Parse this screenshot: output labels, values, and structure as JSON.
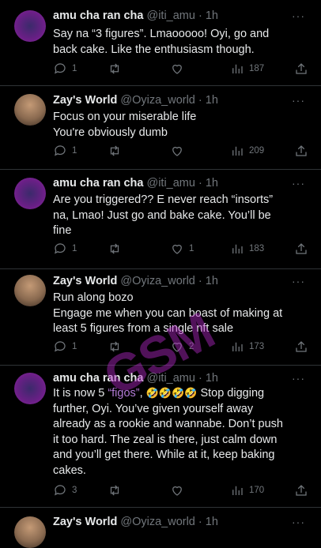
{
  "tweets": [
    {
      "name": "amu cha ran cha",
      "handle": "@iti_amu",
      "sep": "·",
      "time": "1h",
      "text_lines": [
        "Say na “3 figures”. Lmaooooo! Oyi, go and",
        "back cake. Like the enthusiasm though."
      ],
      "replies": "1",
      "retweets": "",
      "likes": "",
      "views": "187"
    },
    {
      "name": "Zay's World",
      "handle": "@Oyiza_world",
      "sep": "·",
      "time": "1h",
      "text_lines": [
        "Focus on your miserable life",
        "You're obviously dumb"
      ],
      "replies": "1",
      "retweets": "",
      "likes": "",
      "views": "209"
    },
    {
      "name": "amu cha ran cha",
      "handle": "@iti_amu",
      "sep": "·",
      "time": "1h",
      "text_lines": [
        "Are you triggered?? E never reach “insorts”",
        "na, Lmao! Just go and bake cake. You’ll be",
        "fine"
      ],
      "replies": "1",
      "retweets": "",
      "likes": "1",
      "views": "183"
    },
    {
      "name": "Zay's World",
      "handle": "@Oyiza_world",
      "sep": "·",
      "time": "1h",
      "text_lines": [
        "Run along bozo",
        "Engage me when you can boast of making at",
        "least 5 figures from a single nft sale"
      ],
      "replies": "1",
      "retweets": "",
      "likes": "2",
      "views": "173"
    },
    {
      "name": "amu cha ran cha",
      "handle": "@iti_amu",
      "sep": "·",
      "time": "1h",
      "line1_pre": "It is now 5 ",
      "line1_hl": "“figos”",
      "line1_mid": ", ",
      "line1_emoji": "🤣🤣🤣🤣",
      "line1_post": " Stop digging",
      "text_lines": [
        "further, Oyi. You’ve given yourself away",
        "already as a rookie and wannabe. Don’t push",
        "it too hard. The zeal is there, just calm down",
        "and you’ll get there. While at it, keep baking",
        "cakes."
      ],
      "replies": "3",
      "retweets": "",
      "likes": "",
      "views": "170"
    },
    {
      "name": "Zay's World",
      "handle": "@Oyiza_world",
      "sep": "·",
      "time": "1h"
    }
  ],
  "more_label": "···",
  "watermark": "GSM"
}
